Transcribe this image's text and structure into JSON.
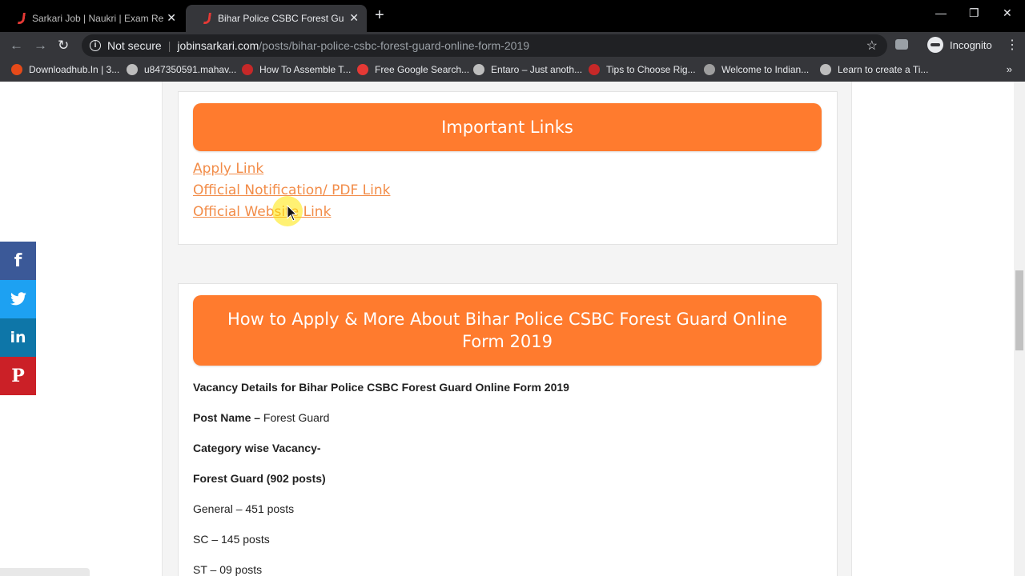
{
  "browser": {
    "tabs": [
      {
        "title": "Sarkari Job | Naukri | Exam Result",
        "active": false
      },
      {
        "title": "Bihar Police CSBC Forest Guard O",
        "active": true
      }
    ],
    "new_tab": "+",
    "window_controls": {
      "minimize": "—",
      "restore": "❐",
      "close": "✕"
    },
    "address": {
      "security": "Not secure",
      "host": "jobinsarkari.com",
      "path": "/posts/bihar-police-csbc-forest-guard-online-form-2019"
    },
    "profile": "Incognito",
    "bookmarks": [
      {
        "label": "Downloadhub.In | 3...",
        "icon_color": "#e64a19"
      },
      {
        "label": "u847350591.mahav...",
        "icon_color": "#bdbdbd"
      },
      {
        "label": "How To Assemble T...",
        "icon_color": "#c62828"
      },
      {
        "label": "Free Google Search...",
        "icon_color": "#e53935"
      },
      {
        "label": "Entaro – Just anoth...",
        "icon_color": "#bdbdbd"
      },
      {
        "label": "Tips to Choose Rig...",
        "icon_color": "#c62828"
      },
      {
        "label": "Welcome to Indian...",
        "icon_color": "#9e9e9e"
      },
      {
        "label": "Learn to create a Ti...",
        "icon_color": "#bdbdbd"
      }
    ],
    "bookmarks_more": "»"
  },
  "page": {
    "important_links": {
      "heading": "Important Links",
      "links": [
        "Apply Link",
        "Official Notification/ PDF Link",
        "Official Website Link"
      ]
    },
    "how_to_apply": {
      "heading": "How to Apply & More About Bihar Police CSBC Forest Guard Online Form 2019",
      "vacancy_title": "Vacancy Details for Bihar Police CSBC Forest Guard Online Form 2019",
      "post_name_label": "Post Name –",
      "post_name_value": " Forest Guard",
      "category_label": "Category wise Vacancy-",
      "total_label": "Forest Guard (902 posts)",
      "rows": [
        "General – 451 posts",
        "SC – 145 posts",
        "ST – 09 posts"
      ]
    },
    "social": [
      {
        "name": "facebook",
        "glyph": "f",
        "color": "#3b5998"
      },
      {
        "name": "twitter",
        "glyph": "t",
        "color": "#1da1f2"
      },
      {
        "name": "linkedin",
        "glyph": "in",
        "color": "#0e76a8"
      },
      {
        "name": "pinterest",
        "glyph": "P",
        "color": "#cb2027"
      }
    ]
  },
  "colors": {
    "accent": "#ff7b2e",
    "link": "#f28c48"
  }
}
